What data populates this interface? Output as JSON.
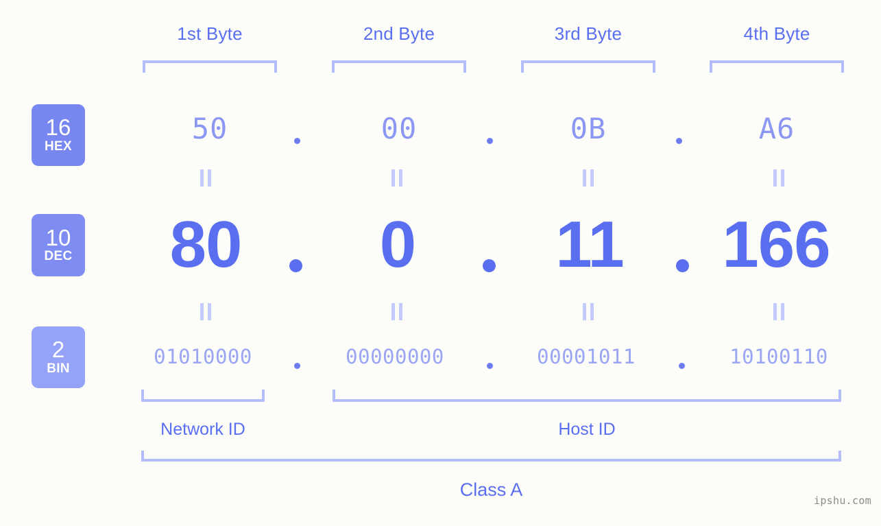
{
  "meta": {
    "background_color": "#fcfdf8",
    "accent_color": "#5a6ef0",
    "light_accent_color": "#b4bdfb",
    "watermark": "ipshu.com"
  },
  "byte_headers": [
    {
      "label": "1st Byte"
    },
    {
      "label": "2nd Byte"
    },
    {
      "label": "3rd Byte"
    },
    {
      "label": "4th Byte"
    }
  ],
  "radix_badges": [
    {
      "number": "16",
      "system": "HEX",
      "color": "#7886ef"
    },
    {
      "number": "10",
      "system": "DEC",
      "color": "#7f8cf2"
    },
    {
      "number": "2",
      "system": "BIN",
      "color": "#94a3f8"
    }
  ],
  "rows": {
    "hex": {
      "values": [
        "50",
        "00",
        "0B",
        "A6"
      ],
      "separator": "."
    },
    "dec": {
      "values": [
        "80",
        "0",
        "11",
        "166"
      ],
      "separator": "."
    },
    "bin": {
      "values": [
        "01010000",
        "00000000",
        "00001011",
        "10100110"
      ],
      "separator": "."
    }
  },
  "equality_marks": {
    "symbol": "=",
    "count_per_row": 4
  },
  "segments": [
    {
      "label": "Network ID"
    },
    {
      "label": "Host ID"
    }
  ],
  "class": {
    "label": "Class A"
  }
}
